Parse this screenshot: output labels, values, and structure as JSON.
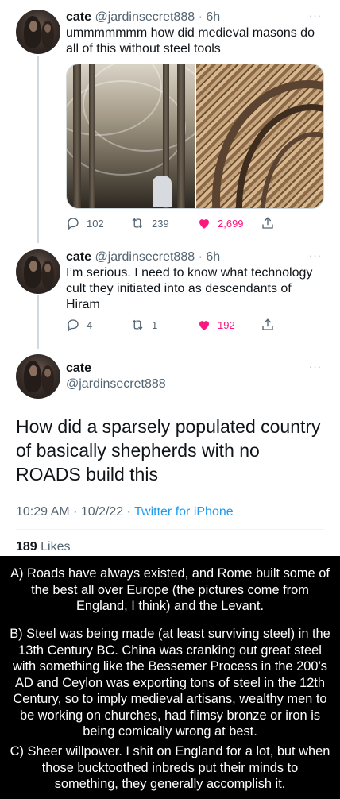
{
  "tweets": [
    {
      "name": "cate",
      "handle": "@jardinsecret888",
      "time": "6h",
      "text": "ummmmmmm how did medieval masons do all of this without steel tools",
      "replies": "102",
      "retweets": "239",
      "likes": "2,699"
    },
    {
      "name": "cate",
      "handle": "@jardinsecret888",
      "time": "6h",
      "text": "I’m serious. I need to know what technology cult they initiated into as descendants of Hiram",
      "replies": "4",
      "retweets": "1",
      "likes": "192"
    }
  ],
  "main_tweet": {
    "name": "cate",
    "handle": "@jardinsecret888",
    "text": "How did a sparsely populated country of basically shepherds with no ROADS build this",
    "timestamp": "10:29 AM · 10/2/22 · ",
    "source": "Twitter for iPhone",
    "likes_count": "189",
    "likes_label": " Likes"
  },
  "separator": " · ",
  "more_glyph": "···",
  "reply_text": {
    "a": "A) Roads have always existed, and Rome built some of the best all over Europe (the pictures come from England, I think) and the Levant.",
    "b": "B) Steel was being made (at least surviving steel) in the 13th Century BC. China was cranking out great steel with something like the Bessemer Process in the 200’s AD and Ceylon was exporting tons of steel in the 12th Century, so to imply medieval artisans, wealthy men to be working on churches, had flimsy bronze or iron is being comically wrong at best.",
    "c": "C) Sheer willpower. I shit on England for a lot, but when those bucktoothed inbreds put their minds to something, they generally accomplish it."
  },
  "colors": {
    "like": "#f91880",
    "link": "#1d9bf0",
    "secondary": "#536471"
  },
  "icons": [
    "reply-icon",
    "retweet-icon",
    "heart-icon",
    "share-icon",
    "more-icon"
  ]
}
